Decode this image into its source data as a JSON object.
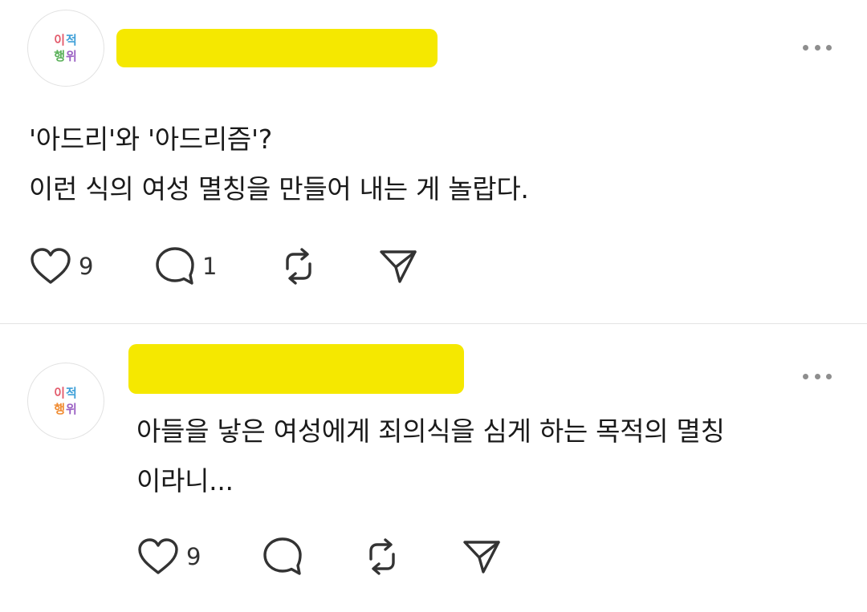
{
  "posts": [
    {
      "avatar": {
        "line1": [
          "이",
          "적"
        ],
        "line2": [
          "행",
          "위"
        ]
      },
      "text_lines": [
        "'아드리'와 '아드리즘'?",
        "이런 식의 여성 멸칭을 만들어 내는 게 놀랍다."
      ],
      "likes": "9",
      "replies": "1"
    },
    {
      "avatar": {
        "line1": [
          "이",
          "적"
        ],
        "line2": [
          "행",
          "위"
        ]
      },
      "text_lines": [
        "아들을 낳은 여성에게 죄의식을 심게 하는 목적의 멸칭",
        "이라니..."
      ],
      "likes": "9",
      "replies": ""
    }
  ],
  "colors": {
    "redaction": "#f5e800",
    "text": "#1a1a1a",
    "icon": "#333333",
    "divider": "#e3e3e3"
  },
  "icons": [
    "heart-icon",
    "reply-bubble-icon",
    "repost-icon",
    "share-send-icon",
    "more-options-icon"
  ]
}
